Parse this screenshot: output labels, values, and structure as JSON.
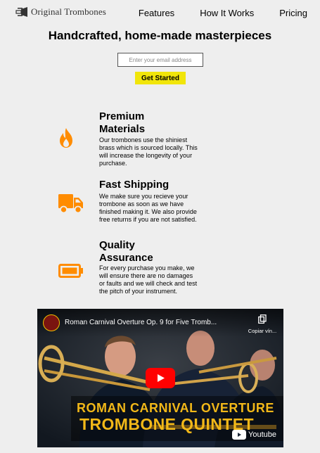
{
  "header": {
    "logo_text": "Original Trombones",
    "nav": [
      {
        "label": "Features"
      },
      {
        "label": "How It Works"
      },
      {
        "label": "Pricing"
      }
    ]
  },
  "hero": {
    "title": "Handcrafted, home-made masterpieces",
    "email_placeholder": "Enter your email address",
    "cta_label": "Get Started"
  },
  "features": [
    {
      "icon": "flame-icon",
      "title": "Premium Materials",
      "description": "Our trombones use the shiniest brass which is sourced locally. This will increase the longevity of your purchase."
    },
    {
      "icon": "truck-icon",
      "title": "Fast Shipping",
      "description": "We make sure you recieve your trombone as soon as we have finished making it. We also provide free returns if you are not satisfied."
    },
    {
      "icon": "battery-icon",
      "title": "Quality Assurance",
      "description": "For every purchase you make, we will ensure there are no damages or faults and we will check and test the pitch of your instrument."
    }
  ],
  "video": {
    "title": "Roman Carnival Overture Op. 9 for Five Tromb...",
    "copy_label": "Copiar vín...",
    "caption_line1": "ROMAN CARNIVAL OVERTURE",
    "caption_line2": "TROMBONE QUINTET",
    "platform_label": "Youtube"
  },
  "colors": {
    "background": "#eeeeee",
    "accent": "#ff8c00",
    "cta": "#f1e50a",
    "video_caption": "#f2b818",
    "play_button": "#ff0000"
  }
}
